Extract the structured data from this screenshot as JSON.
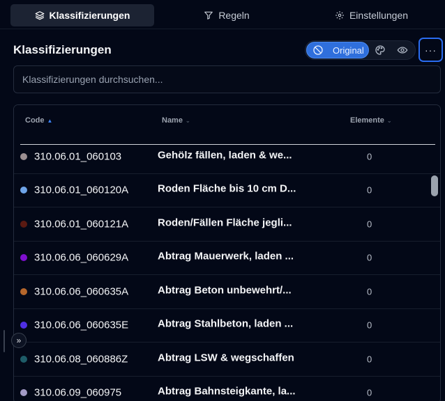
{
  "tabs": [
    {
      "label": "Klassifizierungen",
      "icon": "layers-icon",
      "active": true
    },
    {
      "label": "Regeln",
      "icon": "filter-icon",
      "active": false
    },
    {
      "label": "Einstellungen",
      "icon": "gear-icon",
      "active": false
    }
  ],
  "header": {
    "title": "Klassifizierungen",
    "view_toggle": {
      "active_label": "Original"
    },
    "more_label": "···"
  },
  "search": {
    "placeholder": "Klassifizierungen durchsuchen..."
  },
  "table": {
    "columns": [
      {
        "label": "Code",
        "sort": "asc"
      },
      {
        "label": "Name",
        "sort": "none"
      },
      {
        "label": "Elemente",
        "sort": "none"
      }
    ],
    "rows": [
      {
        "color": "#9b8f92",
        "code": "310.06.01_060103",
        "name": "Gehölz fällen, laden & we...",
        "count": "0"
      },
      {
        "color": "#6ea4e8",
        "code": "310.06.01_060120A",
        "name": "Roden Fläche bis 10 cm D...",
        "count": "0"
      },
      {
        "color": "#5a1a12",
        "code": "310.06.01_060121A",
        "name": "Roden/Fällen Fläche jegli...",
        "count": "0"
      },
      {
        "color": "#7e0fcf",
        "code": "310.06.06_060629A",
        "name": "Abtrag Mauerwerk, laden ...",
        "count": "0"
      },
      {
        "color": "#b5662b",
        "code": "310.06.06_060635A",
        "name": "Abtrag Beton unbewehrt/...",
        "count": "0"
      },
      {
        "color": "#4f2fe3",
        "code": "310.06.06_060635E",
        "name": "Abtrag Stahlbeton, laden ...",
        "count": "0"
      },
      {
        "color": "#1e5c68",
        "code": "310.06.08_060886Z",
        "name": "Abtrag LSW & wegschaffen",
        "count": "0"
      },
      {
        "color": "#a39bc6",
        "code": "310.06.09_060975",
        "name": "Abtrag Bahnsteigkante, la...",
        "count": "0"
      }
    ]
  },
  "sidebar_toggle": {
    "label": "»"
  }
}
